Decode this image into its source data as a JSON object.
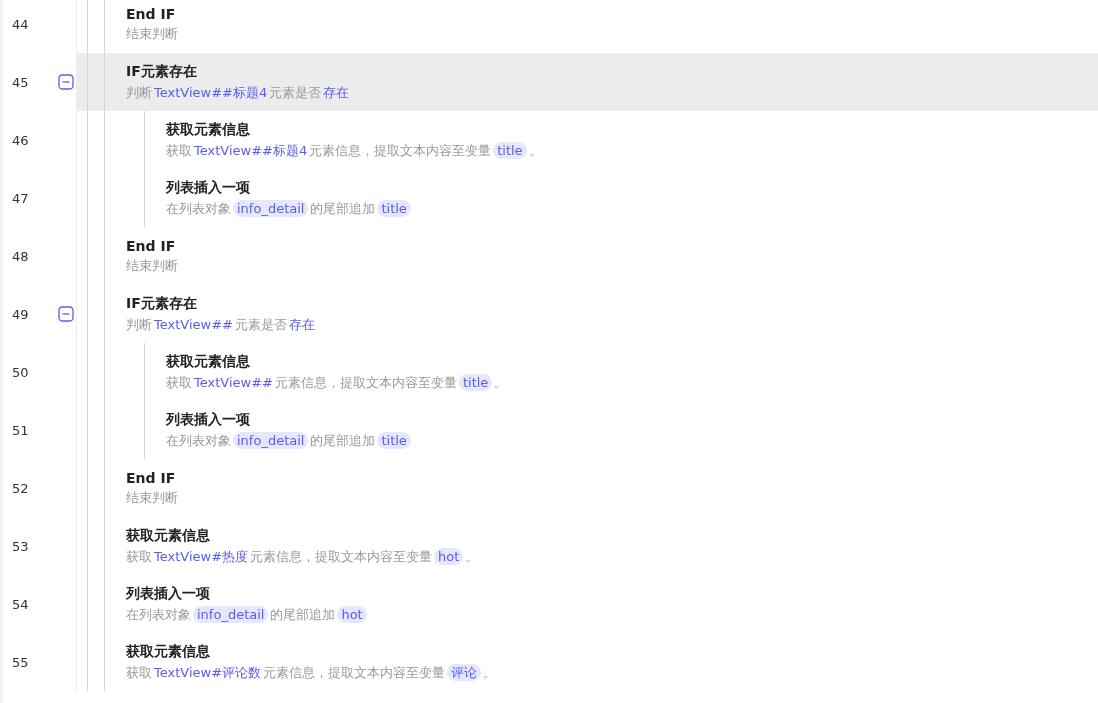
{
  "steps": [
    {
      "line": "44",
      "title": "End IF",
      "selected": false,
      "description": [
        {
          "kind": "text",
          "text": "结束判断"
        }
      ]
    },
    {
      "line": "45",
      "title": "IF元素存在",
      "selected": true,
      "expanded": true,
      "description": [
        {
          "kind": "text",
          "text": "判断"
        },
        {
          "kind": "target",
          "text": "TextView##标题4"
        },
        {
          "kind": "text",
          "text": "元素是否"
        },
        {
          "kind": "target",
          "text": "存在"
        }
      ],
      "children": [
        {
          "line": "46",
          "title": "获取元素信息",
          "selected": false,
          "description": [
            {
              "kind": "text",
              "text": "获取"
            },
            {
              "kind": "target",
              "text": "TextView##标题4"
            },
            {
              "kind": "text",
              "text": "元素信息，提取文本内容至变量"
            },
            {
              "kind": "var",
              "text": "title"
            },
            {
              "kind": "text",
              "text": "。"
            }
          ]
        },
        {
          "line": "47",
          "title": "列表插入一项",
          "selected": false,
          "description": [
            {
              "kind": "text",
              "text": "在列表对象"
            },
            {
              "kind": "var",
              "text": "info_detail"
            },
            {
              "kind": "text",
              "text": "的尾部追加"
            },
            {
              "kind": "var",
              "text": "title"
            }
          ]
        }
      ]
    },
    {
      "line": "48",
      "title": "End IF",
      "selected": false,
      "description": [
        {
          "kind": "text",
          "text": "结束判断"
        }
      ]
    },
    {
      "line": "49",
      "title": "IF元素存在",
      "selected": false,
      "expanded": true,
      "description": [
        {
          "kind": "text",
          "text": "判断"
        },
        {
          "kind": "target",
          "text": "TextView##"
        },
        {
          "kind": "text",
          "text": "元素是否"
        },
        {
          "kind": "target",
          "text": "存在"
        }
      ],
      "children": [
        {
          "line": "50",
          "title": "获取元素信息",
          "selected": false,
          "description": [
            {
              "kind": "text",
              "text": "获取"
            },
            {
              "kind": "target",
              "text": "TextView##"
            },
            {
              "kind": "text",
              "text": "元素信息，提取文本内容至变量"
            },
            {
              "kind": "var",
              "text": "title"
            },
            {
              "kind": "text",
              "text": "。"
            }
          ]
        },
        {
          "line": "51",
          "title": "列表插入一项",
          "selected": false,
          "description": [
            {
              "kind": "text",
              "text": "在列表对象"
            },
            {
              "kind": "var",
              "text": "info_detail"
            },
            {
              "kind": "text",
              "text": "的尾部追加"
            },
            {
              "kind": "var",
              "text": "title"
            }
          ]
        }
      ]
    },
    {
      "line": "52",
      "title": "End IF",
      "selected": false,
      "description": [
        {
          "kind": "text",
          "text": "结束判断"
        }
      ]
    },
    {
      "line": "53",
      "title": "获取元素信息",
      "selected": false,
      "description": [
        {
          "kind": "text",
          "text": "获取"
        },
        {
          "kind": "target",
          "text": "TextView#热度"
        },
        {
          "kind": "text",
          "text": "元素信息，提取文本内容至变量"
        },
        {
          "kind": "var",
          "text": "hot"
        },
        {
          "kind": "text",
          "text": "。"
        }
      ]
    },
    {
      "line": "54",
      "title": "列表插入一项",
      "selected": false,
      "description": [
        {
          "kind": "text",
          "text": "在列表对象"
        },
        {
          "kind": "var",
          "text": "info_detail"
        },
        {
          "kind": "text",
          "text": "的尾部追加"
        },
        {
          "kind": "var",
          "text": "hot"
        }
      ]
    },
    {
      "line": "55",
      "title": "获取元素信息",
      "selected": false,
      "description": [
        {
          "kind": "text",
          "text": "获取"
        },
        {
          "kind": "target",
          "text": "TextView#评论数"
        },
        {
          "kind": "text",
          "text": "元素信息，提取文本内容至变量"
        },
        {
          "kind": "var",
          "text": "评论"
        },
        {
          "kind": "text",
          "text": "。"
        }
      ]
    }
  ]
}
